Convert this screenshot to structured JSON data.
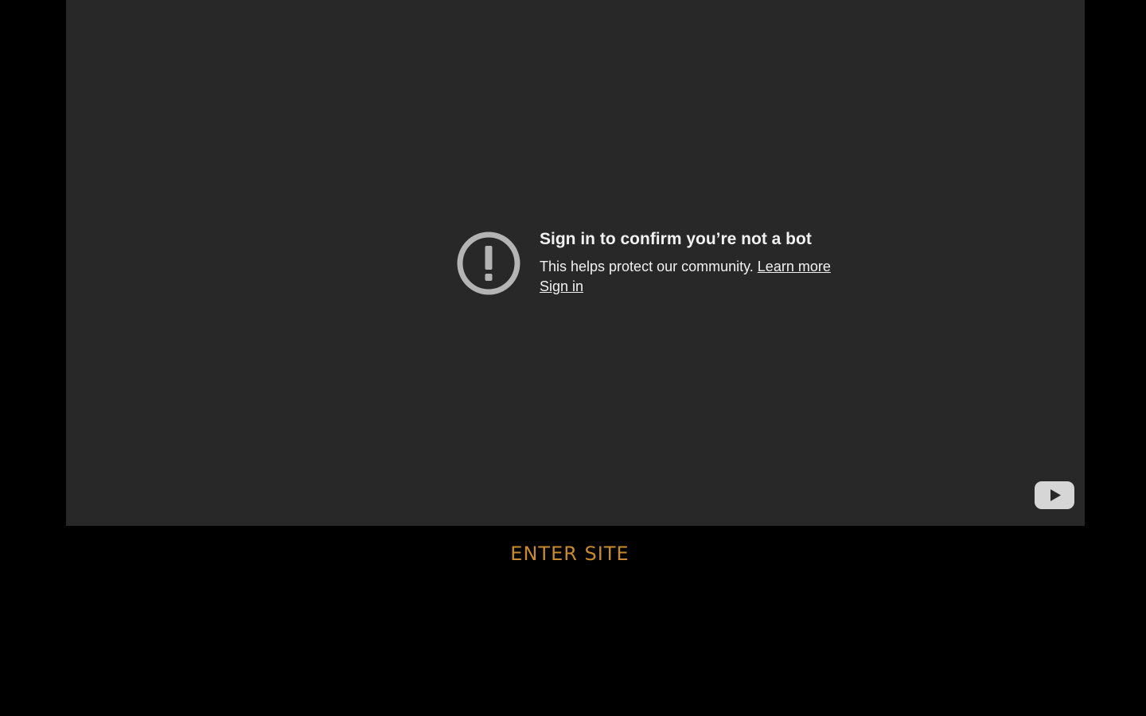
{
  "video": {
    "error": {
      "icon": "exclamation-circle-icon",
      "title": "Sign in to confirm you’re not a bot",
      "subtitle": "This helps protect our community.",
      "learn_more_label": "Learn more",
      "sign_in_label": "Sign in"
    },
    "logo_icon": "youtube-play-icon"
  },
  "enter_site": {
    "label": "ENTER SITE"
  },
  "colors": {
    "page_background": "#000000",
    "player_background": "#282828",
    "text": "#f1f1f1",
    "icon_gray": "#b4b4b4",
    "accent": "#c88a2e"
  }
}
